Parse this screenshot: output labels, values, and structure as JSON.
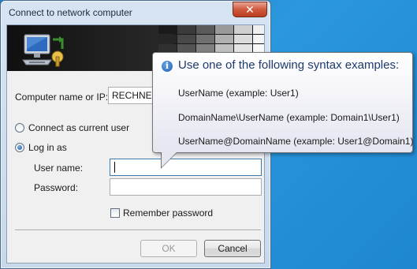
{
  "window": {
    "title": "Connect to network computer"
  },
  "banner": {
    "tile_colors": [
      [
        "#1b1b1b",
        "#3a3a3a",
        "#5a5a5a",
        "#9a9a9a",
        "#d0d0d0",
        "#f0f0f0"
      ],
      [
        "#262626",
        "#484848",
        "#707070",
        "#b0b0b0",
        "#dcdcdc",
        "#f5f5f5"
      ],
      [
        "#303030",
        "#555555",
        "#808080",
        "#c0c0c0",
        "#e4e4e4",
        "#f8f8f8"
      ],
      [
        "#232323",
        "#444444",
        "#6c6c6c",
        "#a8a8a8",
        "#d6d6d6",
        "#f2f2f2"
      ],
      [
        "#1e1e1e",
        "#3c3c3c",
        "#606060",
        "#a0a0a0",
        "#cfcfcf",
        "#efefef"
      ]
    ]
  },
  "form": {
    "computer_name_label": "Computer name or IP:",
    "computer_name_value": "RECHNER",
    "connect_current_user_label": "Connect as current user",
    "log_in_as_label": "Log in as",
    "username_label": "User name:",
    "username_value": "",
    "password_label": "Password:",
    "password_value": "",
    "remember_password_label": "Remember password",
    "selected_option": "log_in_as",
    "remember_password_checked": false
  },
  "buttons": {
    "ok_label": "OK",
    "cancel_label": "Cancel"
  },
  "tooltip": {
    "title": "Use one of the following syntax examples:",
    "lines": [
      "UserName (example: User1)",
      "DomainName\\UserName (example: Domain1\\User1)",
      "UserName@DomainName (example: User1@Domain1)"
    ]
  },
  "icons": {
    "close": "close-icon",
    "info": "info-icon",
    "computer": "network-computer-icon"
  }
}
